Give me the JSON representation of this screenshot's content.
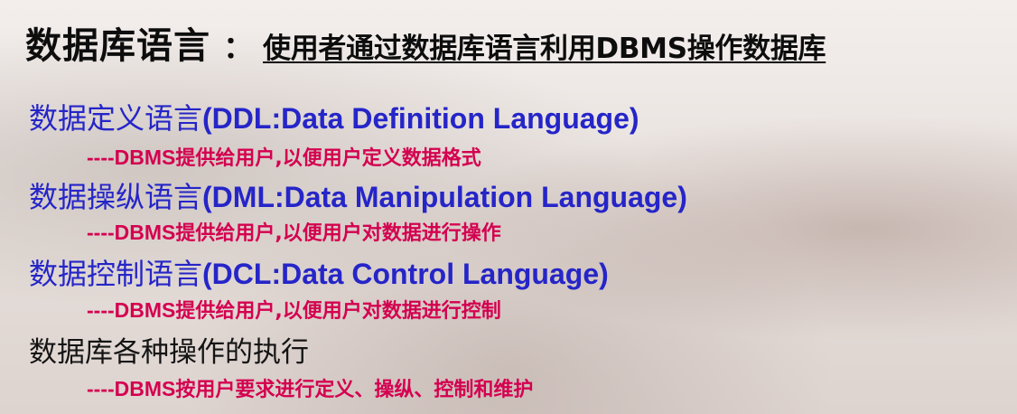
{
  "title": {
    "main": "数据库语言",
    "colon": "：",
    "subtitle": "使用者通过数据库语言利用DBMS操作数据库"
  },
  "sections": [
    {
      "heading_cn": "数据定义语言",
      "heading_en": "(DDL:Data Definition Language)",
      "desc_prefix": "----DBMS",
      "desc_text": "提供给用户,以便用户定义数据格式"
    },
    {
      "heading_cn": "数据操纵语言",
      "heading_en": "(DML:Data Manipulation Language)",
      "desc_prefix": "----DBMS",
      "desc_text": "提供给用户,以便用户对数据进行操作"
    },
    {
      "heading_cn": "数据控制语言",
      "heading_en": "(DCL:Data Control Language)",
      "desc_prefix": "----DBMS",
      "desc_text": "提供给用户,以便用户对数据进行控制"
    },
    {
      "heading_cn": "数据库各种操作的执行",
      "heading_en": "",
      "desc_prefix": "----DBMS",
      "desc_text": "按用户要求进行定义、操纵、控制和维护"
    }
  ],
  "colors": {
    "title": "#0d0d0d",
    "heading": "#2525c8",
    "heading_last": "#141414",
    "description": "#d4004f"
  }
}
